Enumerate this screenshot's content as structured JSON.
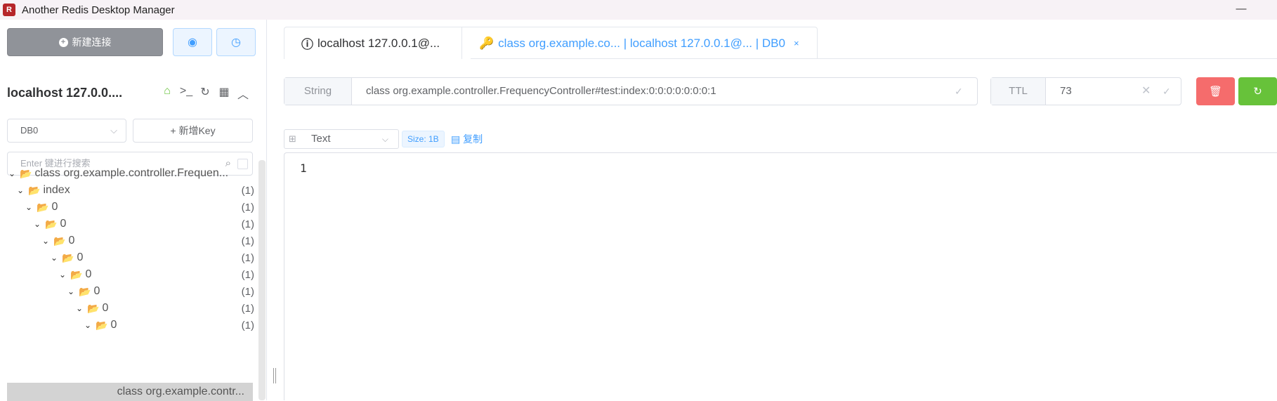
{
  "window": {
    "title": "Another Redis Desktop Manager",
    "minimize_glyph": "—"
  },
  "sidebar": {
    "new_connection_label": "新建连接",
    "connection_name": "localhost 127.0.0....",
    "db_select": "DB0",
    "add_key_label": "新增Key",
    "search_placeholder": "Enter 键进行搜索",
    "tree": [
      {
        "label": "class org.example.controller.Frequen...",
        "count": ""
      },
      {
        "label": "index",
        "count": "(1)"
      },
      {
        "label": "0",
        "count": "(1)"
      },
      {
        "label": "0",
        "count": "(1)"
      },
      {
        "label": "0",
        "count": "(1)"
      },
      {
        "label": "0",
        "count": "(1)"
      },
      {
        "label": "0",
        "count": "(1)"
      },
      {
        "label": "0",
        "count": "(1)"
      },
      {
        "label": "0",
        "count": "(1)"
      },
      {
        "label": "0",
        "count": "(1)"
      }
    ],
    "selected_key": "class org.example.contr..."
  },
  "tabs": [
    {
      "label": "localhost 127.0.0.1@...",
      "icon": "info-icon"
    },
    {
      "label": "class org.example.co... | localhost 127.0.0.1@... | DB0",
      "icon": "key-icon",
      "close": "×"
    }
  ],
  "key": {
    "type_label": "String",
    "name": "class org.example.controller.FrequencyController#test:index:0:0:0:0:0:0:0:1",
    "ttl_label": "TTL",
    "ttl_value": "73"
  },
  "viewer": {
    "format": "Text",
    "size_tag": "Size: 1B",
    "copy_label": "复制",
    "line_number": "1"
  },
  "colors": {
    "primary": "#409eff",
    "danger": "#f56c6c",
    "success": "#67c23a",
    "info": "#909399"
  }
}
